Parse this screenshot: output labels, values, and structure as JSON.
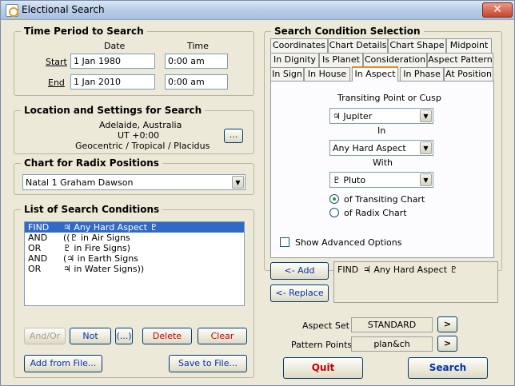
{
  "window": {
    "title": "Electional Search",
    "close_glyph": "✕"
  },
  "time_period": {
    "title": "Time Period to Search",
    "col_date": "Date",
    "col_time": "Time",
    "start_label": "Start",
    "start_date": "1 Jan 1980",
    "start_time": "0:00 am",
    "end_label": "End",
    "end_date": "1 Jan 2010",
    "end_time": "0:00 am"
  },
  "location": {
    "title": "Location and Settings for Search",
    "line1": "Adelaide, Australia",
    "line2": "UT +0:00",
    "line3": "Geocentric / Tropical / Placidus",
    "browse_label": "..."
  },
  "radix": {
    "title": "Chart for Radix Positions",
    "selected": "Natal 1 Graham Dawson"
  },
  "conditions": {
    "title": "List of Search Conditions",
    "rows": [
      {
        "op": "FIND",
        "text": "♃ Any Hard Aspect ♇"
      },
      {
        "op": "AND",
        "text": "((♇ in Air Signs"
      },
      {
        "op": "OR",
        "text": "♇ in Fire Signs)"
      },
      {
        "op": "AND",
        "text": "(♃ in Earth Signs"
      },
      {
        "op": "OR",
        "text": "♃ in Water Signs))"
      }
    ],
    "and_or_label": "And/Or",
    "not_label": "Not",
    "paren_label": "(...)",
    "delete_label": "Delete",
    "clear_label": "Clear",
    "add_file_label": "Add from File...",
    "save_file_label": "Save to File..."
  },
  "selection": {
    "title": "Search Condition Selection",
    "tabs_row1": [
      "Coordinates",
      "Chart Details",
      "Chart Shape",
      "Midpoint"
    ],
    "tabs_row2": [
      "In Dignity",
      "Is Planet",
      "Consideration",
      "Aspect Pattern"
    ],
    "tabs_row3": [
      "In Sign",
      "In House",
      "In Aspect",
      "In Phase",
      "At Position"
    ],
    "transiting_label": "Transiting Point or Cusp",
    "transiting_value": "♃ Jupiter",
    "in_label": "In",
    "in_value": "Any Hard Aspect",
    "with_label": "With",
    "with_value": "♇ Pluto",
    "radio_transiting": "of Transiting Chart",
    "radio_radix": "of Radix Chart",
    "advanced_label": "Show Advanced Options"
  },
  "actions": {
    "add_label": "<- Add",
    "replace_label": "<- Replace",
    "preview_op": "FIND",
    "preview_text": "♃ Any Hard Aspect ♇",
    "aspect_set_label": "Aspect Set",
    "aspect_set_value": "STANDARD",
    "pattern_points_label": "Pattern Points",
    "pattern_points_value": "plan&ch",
    "arrow_label": ">",
    "quit_label": "Quit",
    "search_label": "Search"
  }
}
